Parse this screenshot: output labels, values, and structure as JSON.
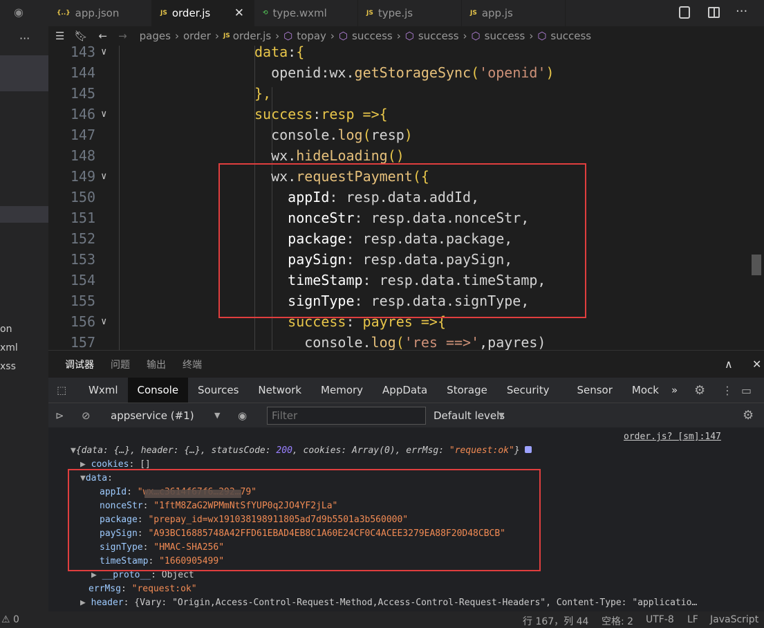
{
  "activity_bar": {
    "side_labels": [
      "on",
      "xml",
      "xss"
    ]
  },
  "tabs": [
    {
      "icon": "{..}",
      "label": "app.json"
    },
    {
      "icon": "JS",
      "label": "order.js",
      "close": "✕"
    },
    {
      "icon": "⟲",
      "label": "type.wxml"
    },
    {
      "icon": "JS",
      "label": "type.js"
    },
    {
      "icon": "JS",
      "label": "app.js"
    }
  ],
  "breadcrumb": [
    "pages",
    "order",
    "order.js",
    "topay",
    "success",
    "success",
    "success",
    "success"
  ],
  "editor": {
    "lines": [
      {
        "n": "143",
        "fold": true
      },
      {
        "n": "144"
      },
      {
        "n": "145"
      },
      {
        "n": "146",
        "fold": true
      },
      {
        "n": "147"
      },
      {
        "n": "148"
      },
      {
        "n": "149",
        "fold": true
      },
      {
        "n": "150"
      },
      {
        "n": "151"
      },
      {
        "n": "152"
      },
      {
        "n": "153"
      },
      {
        "n": "154"
      },
      {
        "n": "155"
      },
      {
        "n": "156",
        "fold": true
      },
      {
        "n": "157"
      }
    ],
    "code": {
      "l143a": "data",
      ":a": ":",
      "l143b": "{",
      "l144a": "openid",
      ":b": ":",
      "l144b": "wx",
      "dot": ".",
      "l144c": "getStorageSync",
      "l144d": "(",
      "l144e": "'openid'",
      "l144f": ")",
      "l145": "},",
      "l146a": "success",
      ":c": ":",
      "l146b": "resp",
      "l146c": " =>",
      "l146d": "{",
      "l147a": "console",
      "l147b": "log",
      "l147c": "(",
      "l147d": "resp",
      "l147e": ")",
      "l148a": "wx",
      "l148b": "hideLoading",
      "l148c": "()",
      "l149a": "wx",
      "l149b": "requestPayment",
      "l149c": "({",
      "l150a": "appId",
      "l150b": ": resp.data.addId,",
      "l151a": "nonceStr",
      "l151b": ": resp.data.nonceStr,",
      "l152a": "package",
      "l152b": ": resp.data.package,",
      "l153a": "paySign",
      "l153b": ": resp.data.paySign,",
      "l154a": "timeStamp",
      "l154b": ": resp.data.timeStamp,",
      "l155a": "signType",
      "l155b": ": resp.data.signType,",
      "l156a": "success",
      ":d": ":",
      "l156b": " payres",
      "l156c": " =>",
      "l156d": "{",
      "l157a": "console",
      "l157b": "log",
      "l157c": "(",
      "l157d": "'res ==>'",
      "l157e": ",payres)"
    }
  },
  "panel": {
    "tabs": [
      "调试器",
      "问题",
      "输出",
      "终端"
    ],
    "devtools_tabs": [
      "Wxml",
      "Console",
      "Sources",
      "Network",
      "Memory",
      "AppData",
      "Storage",
      "Security",
      "Sensor",
      "Mock",
      "»"
    ],
    "context": "appservice (#1)",
    "filter_placeholder": "Filter",
    "levels": "Default levels",
    "source_link": "order.js? [sm]:147",
    "console": {
      "summary_open": "{data: {…}, header: {…}, statusCode: ",
      "status_code": "200",
      "summary_mid": ", cookies: Array(0), errMsg: ",
      "summary_err": "\"request:ok\"",
      "summary_close": "}",
      "cookies_key": "cookies",
      "cookies_val": ": []",
      "data_key": "data",
      "appId_key": "appId",
      "appId_val": "\"wx…c3614f67f6…292…79\"",
      "nonceStr_key": "nonceStr",
      "nonceStr_val": "\"1ftM8ZaG2WPMmNtSfYUP0q2JO4YF2jLa\"",
      "package_key": "package",
      "package_val": "\"prepay_id=wx191038198911805ad7d9b5501a3b560000\"",
      "paySign_key": "paySign",
      "paySign_val": "\"A93BC16885748A42FFD61EBAD4EB8C1A60E24CF0C4ACEE3279EA88F20D48CBCB\"",
      "signType_key": "signType",
      "signType_val": "\"HMAC-SHA256\"",
      "timeStamp_key": "timeStamp",
      "timeStamp_val": "\"1660905499\"",
      "proto_key": "__proto__",
      "proto_val": ": Object",
      "errMsg_key": "errMsg",
      "errMsg_val": "\"request:ok\"",
      "header_key": "header",
      "header_val": ": {Vary: \"Origin,Access-Control-Request-Method,Access-Control-Request-Headers\", Content-Type: \"applicatio…"
    }
  },
  "status": {
    "warnings": "⚠ 0",
    "position": "行 167，列 44",
    "spaces": "空格: 2",
    "encoding": "UTF-8",
    "eol": "LF",
    "language": "JavaScript"
  },
  "colors": {
    "accent_red": "#e03e3e",
    "keyword_yellow": "#e8c64a",
    "string_orange": "#ce9178"
  }
}
